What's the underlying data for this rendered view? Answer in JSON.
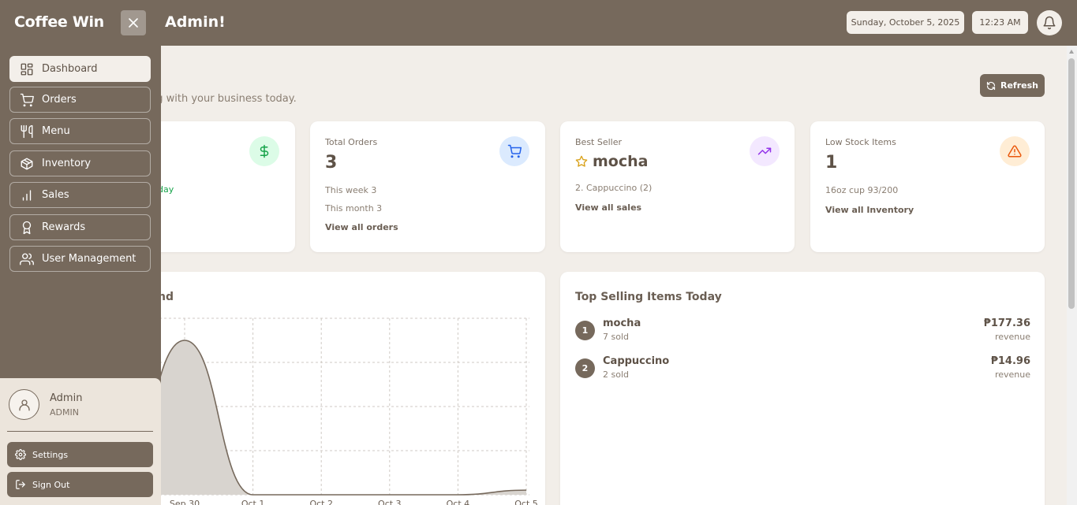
{
  "app": {
    "brand": "Coffee Win",
    "greeting": "Admin!"
  },
  "header": {
    "date": "Sunday, October 5, 2025",
    "time": "12:23 AM"
  },
  "sidebar": {
    "items": [
      {
        "label": "Dashboard",
        "icon": "dashboard-icon",
        "active": true
      },
      {
        "label": "Orders",
        "icon": "cart-icon"
      },
      {
        "label": "Menu",
        "icon": "utensils-icon"
      },
      {
        "label": "Inventory",
        "icon": "box-icon"
      },
      {
        "label": "Sales",
        "icon": "bar-chart-icon"
      },
      {
        "label": "Rewards",
        "icon": "award-icon"
      },
      {
        "label": "User Management",
        "icon": "users-icon"
      }
    ],
    "user": {
      "name": "Admin",
      "role": "ADMIN"
    },
    "settings_label": "Settings",
    "signout_label": "Sign Out"
  },
  "main": {
    "subtitle_fragment": "ng with your business today.",
    "refresh_label": "Refresh",
    "revenue_card": {
      "sub_fragment": "day",
      "icon": "dollar-icon"
    },
    "orders_card": {
      "label": "Total Orders",
      "value": "3",
      "week": "This week 3",
      "month": "This month 3",
      "link": "View all orders",
      "icon": "cart-icon"
    },
    "bestseller_card": {
      "label": "Best Seller",
      "value": "mocha",
      "second": "2. Cappuccino (2)",
      "link": "View all sales",
      "icon": "trending-up-icon"
    },
    "lowstock_card": {
      "label": "Low Stock Items",
      "value": "1",
      "detail": "16oz cup 93/200",
      "link": "View all Inventory",
      "icon": "alert-triangle-icon"
    },
    "trend_panel": {
      "title_fragment": "nd"
    },
    "top_selling": {
      "title": "Top Selling Items Today",
      "items": [
        {
          "rank": "1",
          "name": "mocha",
          "sold": "7 sold",
          "revenue": "₱177.36",
          "revenue_label": "revenue"
        },
        {
          "rank": "2",
          "name": "Cappuccino",
          "sold": "2 sold",
          "revenue": "₱14.96",
          "revenue_label": "revenue"
        }
      ]
    }
  },
  "colors": {
    "primary": "#76695c",
    "background": "#f2eee9",
    "revenue_green": "#16a34a",
    "orders_blue": "#2563eb",
    "best_purple": "#9333ea",
    "stock_orange": "#ea580c",
    "star_gold": "#d9a21b"
  },
  "chart_data": {
    "type": "area",
    "x": [
      "Sep 30",
      "Oct 1",
      "Oct 2",
      "Oct 3",
      "Oct 4",
      "Oct 5"
    ],
    "values": [
      1.0,
      0,
      0,
      0,
      0,
      0.03
    ],
    "xlabel": "",
    "ylabel": "",
    "grid": true
  }
}
